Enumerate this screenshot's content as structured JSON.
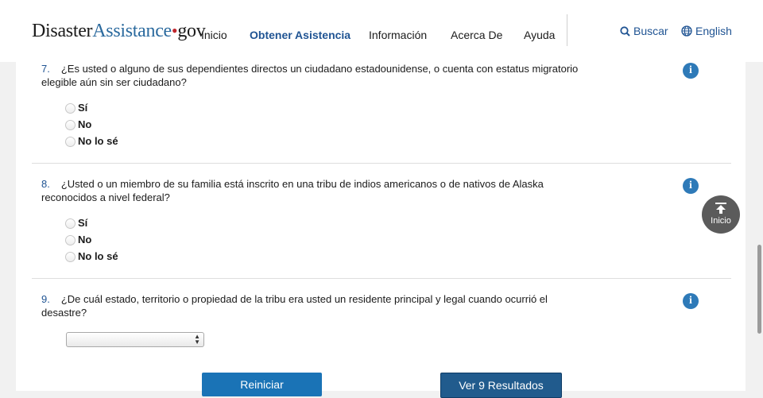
{
  "header": {
    "logo": {
      "part1": "Disaster",
      "part2": "Assistance",
      "part3": "gov"
    },
    "nav": [
      {
        "label": "Inicio"
      },
      {
        "label": "Obtener Asistencia",
        "active": true
      },
      {
        "label": "Información"
      },
      {
        "label": "Acerca De"
      },
      {
        "label": "Ayuda"
      }
    ],
    "search_label": "Buscar",
    "language_label": "English"
  },
  "questions": [
    {
      "number": "7.",
      "text": "¿Es usted o alguno de sus dependientes directos un ciudadano estadounidense, o cuenta con estatus migratorio elegible aún sin ser ciudadano?",
      "options": [
        "Sí",
        "No",
        "No lo sé"
      ]
    },
    {
      "number": "8.",
      "text": "¿Usted o un miembro de su familia está inscrito en una tribu de indios americanos o de nativos de Alaska reconocidos a nivel federal?",
      "options": [
        "Sí",
        "No",
        "No lo sé"
      ]
    },
    {
      "number": "9.",
      "text": "¿De cuál estado, territorio o propiedad de la tribu era usted un residente principal y legal cuando ocurrió el desastre?",
      "select_value": ""
    }
  ],
  "buttons": {
    "reset": "Reiniciar",
    "results": "Ver 9 Resultados"
  },
  "back_to_top": "Inicio",
  "colors": {
    "accent": "#205493",
    "button": "#1a73b6",
    "info": "#2e7ab8"
  }
}
